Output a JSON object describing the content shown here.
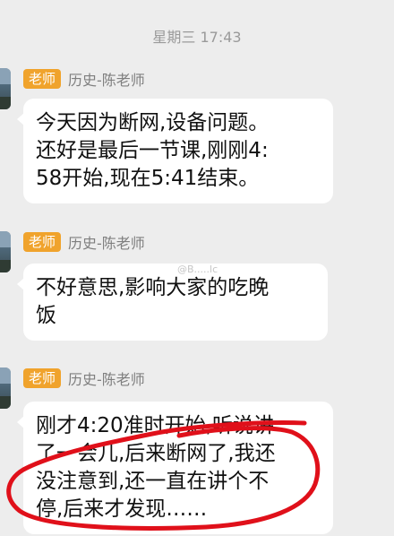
{
  "timestamp": "星期三 17:43",
  "messages": [
    {
      "badge": "老师",
      "sender": "历史-陈老师",
      "lines": [
        "今天因为断网,设备问题。",
        "还好是最后一节课,刚刚4:",
        "58开始,现在5:41结束。"
      ]
    },
    {
      "badge": "老师",
      "sender": "历史-陈老师",
      "lines": [
        "不好意思,影响大家的吃晚",
        "饭"
      ]
    },
    {
      "badge": "老师",
      "sender": "历史-陈老师",
      "lines": [
        "刚才4:20准时开始,听说讲",
        "了一会儿,后来断网了,我还",
        "没注意到,还一直在讲个不",
        "停,后来才发现……"
      ]
    }
  ],
  "colors": {
    "badge": "#f0a32c",
    "background": "#ededed",
    "annotation": "#e0101a"
  },
  "watermark": "@B.....lc"
}
